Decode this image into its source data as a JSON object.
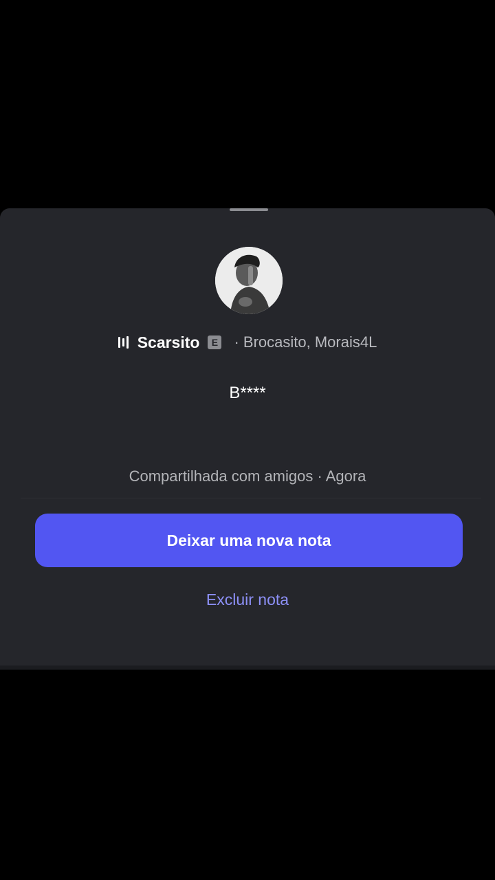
{
  "note": {
    "song_title": "Scarsito",
    "explicit_badge": "E",
    "artists": "· Brocasito, Morais4L",
    "text": "B****",
    "shared_info": "Compartilhada com amigos · Agora"
  },
  "actions": {
    "primary_label": "Deixar uma nova nota",
    "secondary_label": "Excluir nota"
  },
  "icons": {
    "music": "audio-bars-icon",
    "explicit": "explicit-icon"
  },
  "colors": {
    "sheet_background": "#25262b",
    "primary_button": "#5256f2",
    "link": "#8d90f7"
  }
}
